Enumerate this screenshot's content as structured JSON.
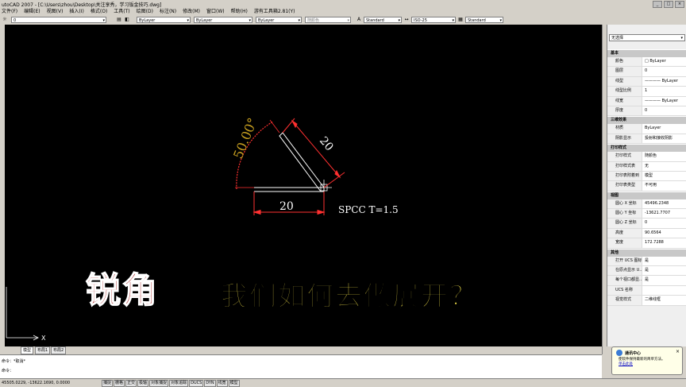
{
  "window": {
    "title": "utoCAD 2007 - [C:\\Users\\zhou\\Desktop\\关注享秀，学习钣金技巧.dwg]"
  },
  "menu": [
    "文件(F)",
    "编辑(E)",
    "视图(V)",
    "插入(I)",
    "格式(O)",
    "工具(T)",
    "绘图(D)",
    "标注(N)",
    "修改(M)",
    "窗口(W)",
    "帮助(H)",
    "游有工具箱2.81(Y)"
  ],
  "toolbar": {
    "layer": "0",
    "color": "ByLayer",
    "linetype": "ByLayer",
    "lineweight": "ByLayer",
    "plotstyle": "随颜色",
    "textstyle": "Standard",
    "dimstyle": "ISO-25",
    "tablestyle": "Standard"
  },
  "drawing": {
    "angle_label": "50.00°",
    "dim_top": "20",
    "dim_bottom": "20",
    "note": "SPCC T=1.5",
    "ucs_x": "X"
  },
  "caption": {
    "big": "锐角",
    "small": "我们如何去做展开？"
  },
  "palette": {
    "selector": "无选择",
    "sections": [
      {
        "title": "基本",
        "rows": [
          [
            "颜色",
            "□ ByLayer"
          ],
          [
            "图层",
            "0"
          ],
          [
            "线型",
            "———— ByLayer"
          ],
          [
            "线型比例",
            "1"
          ],
          [
            "线宽",
            "———— ByLayer"
          ],
          [
            "厚度",
            "0"
          ]
        ]
      },
      {
        "title": "三维效果",
        "rows": [
          [
            "材质",
            "ByLayer"
          ],
          [
            "阴影显示",
            "投射和接收阴影"
          ]
        ]
      },
      {
        "title": "打印样式",
        "rows": [
          [
            "打印样式",
            "随颜色"
          ],
          [
            "打印样式表",
            "无"
          ],
          [
            "打印表附着到",
            "模型"
          ],
          [
            "打印表类型",
            "不可用"
          ]
        ]
      },
      {
        "title": "视图",
        "rows": [
          [
            "圆心 X 坐标",
            "45496.2348"
          ],
          [
            "圆心 Y 坐标",
            "-13621.7707"
          ],
          [
            "圆心 Z 坐标",
            "0"
          ],
          [
            "高度",
            "90.6564"
          ],
          [
            "宽度",
            "172.7288"
          ]
        ]
      },
      {
        "title": "其他",
        "rows": [
          [
            "打开 UCS 图标",
            "是"
          ],
          [
            "在原点显示 U...",
            "是"
          ],
          [
            "每个视口都显...",
            "是"
          ],
          [
            "UCS 名称",
            ""
          ],
          [
            "视觉样式",
            "二维线框"
          ]
        ]
      }
    ]
  },
  "tabs": [
    "模型",
    "布局1",
    "布局2"
  ],
  "command": {
    "line1": "命令：*取消*",
    "line2": "命令："
  },
  "status": {
    "coords": "45505.0229, -13622.1690, 0.0000",
    "toggles": [
      "捕捉",
      "栅格",
      "正交",
      "极轴",
      "对象捕捉",
      "对象追踪",
      "DUCS",
      "DYN",
      "线宽",
      "模型"
    ]
  },
  "notify": {
    "title": "通讯中心",
    "message": "使软件保持最新的简单方法。",
    "link": "单击此处"
  },
  "colors": {
    "canvas": "#000000",
    "dimension": "#ff3030",
    "arc_text": "#c8a020",
    "caption_red": "#a01818",
    "caption_yellow": "#f2e14a"
  }
}
